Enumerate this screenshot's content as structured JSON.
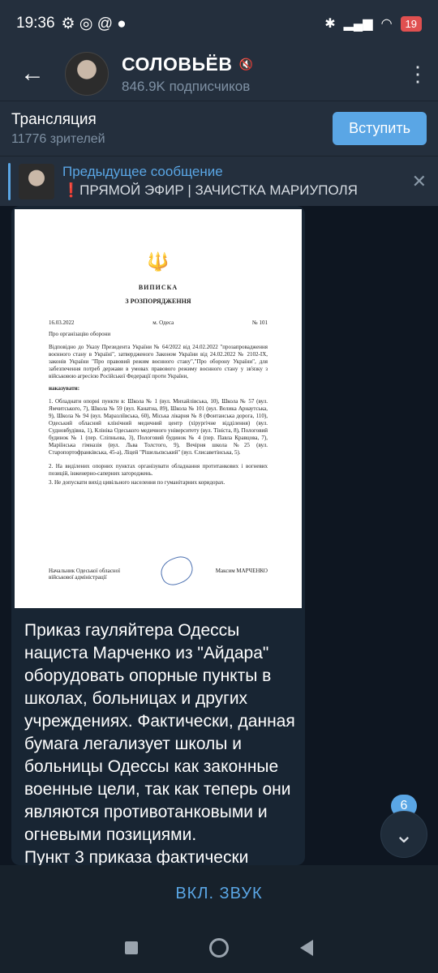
{
  "status": {
    "time": "19:36",
    "battery": "19"
  },
  "header": {
    "title": "СОЛОВЬЁВ",
    "subscribers": "846.9K подписчиков"
  },
  "broadcast": {
    "title": "Трансляция",
    "viewers": "11776 зрителей",
    "join_label": "Вступить"
  },
  "pinned": {
    "label": "Предыдущее сообщение",
    "text": "❗ПРЯМОЙ ЭФИР | ЗАЧИСТКА МАРИУПОЛЯ"
  },
  "document": {
    "heading": "ВИПИСКА",
    "subheading": "З РОЗПОРЯДЖЕННЯ",
    "date": "16.03.2022",
    "city": "м. Одеса",
    "number": "№ 101",
    "subject": "Про організацію оборони",
    "body1": "Відповідно до Указу Президента України № 64/2022 від 24.02.2022 \"прозапровадження воєнного стану в Україні\", затвердженого Законом України від 24.02.2022 № 2102-IX, законів України \"Про правовий режим воєнного стану\",\"Про оборону України\", для забезпечення потреб держави в умовах правового режиму воєнного стану у зв'язку з військовою агресією Російської Федерації проти України,",
    "order_word": "наказувати:",
    "body2": "1. Обладнати опорні пункти в: Школа № 1 (вул. Михайлівська, 10), Школа № 57 (вул. Ямчитського, 7), Школа № 59 (вул. Канатна, 89), Школа № 101 (вул. Велика Арнаутська, 9), Школа № 94 (вул. Маразліївська, 60), Міська лікарня № 8 (Фонтанська дорога, 110), Одеський обласний клінічний медичний центр (хірургічне відділення) (вул. Судновбудівна, 1), Клініка Одеського медичного університету (вул. Тініста, 8), Пологовий будинок № 1 (пер. Сліпньова, 3), Пологовий будинок № 4 (пер. Павла Кравцова, 7), Маріїнська гімназія (вул. Льва Толстого, 9), Вечірня школа №25 (вул. Старопортофранківська, 45-а), Ліцей \"Рішельєвський\" (вул. Єлисаветінська, 5).",
    "body3": "2. На виділених опорних пунктах організувати обладнання протитанкових і вогневих позицій, інженерно-саперних загороджень.",
    "body4": "3. Не допускати вихід цивільного населення по гуманітарних коридорах.",
    "sign_left": "Начальник Одеської обласної військової адміністрації",
    "sign_right": "Максим МАРЧЕНКО"
  },
  "message": {
    "text": "Приказ гауляйтера Одессы нациста Марченко из \"Айдара\" оборудовать опорные пункты в школах, больницах и других учреждениях. Фактически, данная бумага легализует школы и больницы Одессы как законные военные цели, так как теперь они являются противотанковыми и огневыми позициями.",
    "text_cut": "Пункт 3 приказа фактически"
  },
  "scroll": {
    "unread_count": "6"
  },
  "footer": {
    "sound_label": "ВКЛ. ЗВУК"
  }
}
